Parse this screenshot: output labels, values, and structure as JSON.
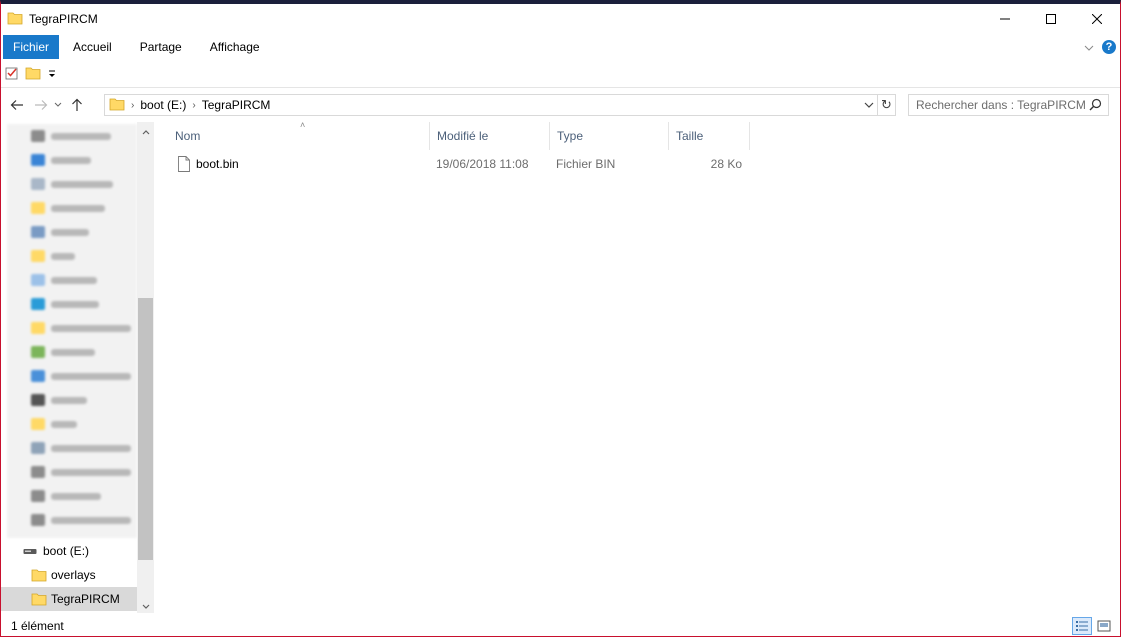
{
  "window": {
    "title": "TegraPIRCM"
  },
  "ribbon": {
    "tabs": [
      {
        "label": "Fichier",
        "active": true
      },
      {
        "label": "Accueil",
        "active": false
      },
      {
        "label": "Partage",
        "active": false
      },
      {
        "label": "Affichage",
        "active": false
      }
    ]
  },
  "address": {
    "crumbs": [
      "boot (E:)",
      "TegraPIRCM"
    ]
  },
  "search": {
    "placeholder": "Rechercher dans : TegraPIRCM"
  },
  "navpane": {
    "items": [
      {
        "label": "boot (E:)",
        "icon": "drive-icon",
        "selected": false
      },
      {
        "label": "overlays",
        "icon": "folder-icon",
        "selected": false
      },
      {
        "label": "TegraPIRCM",
        "icon": "folder-icon",
        "selected": true
      }
    ]
  },
  "columns": {
    "name": "Nom",
    "modified": "Modifié le",
    "type": "Type",
    "size": "Taille"
  },
  "files": [
    {
      "name": "boot.bin",
      "modified": "19/06/2018 11:08",
      "type": "Fichier BIN",
      "size": "28 Ko"
    }
  ],
  "status": {
    "count": "1 élément"
  },
  "colors": {
    "accent": "#1979ca",
    "folder": "#ffd966",
    "header_text": "#4c607a"
  }
}
